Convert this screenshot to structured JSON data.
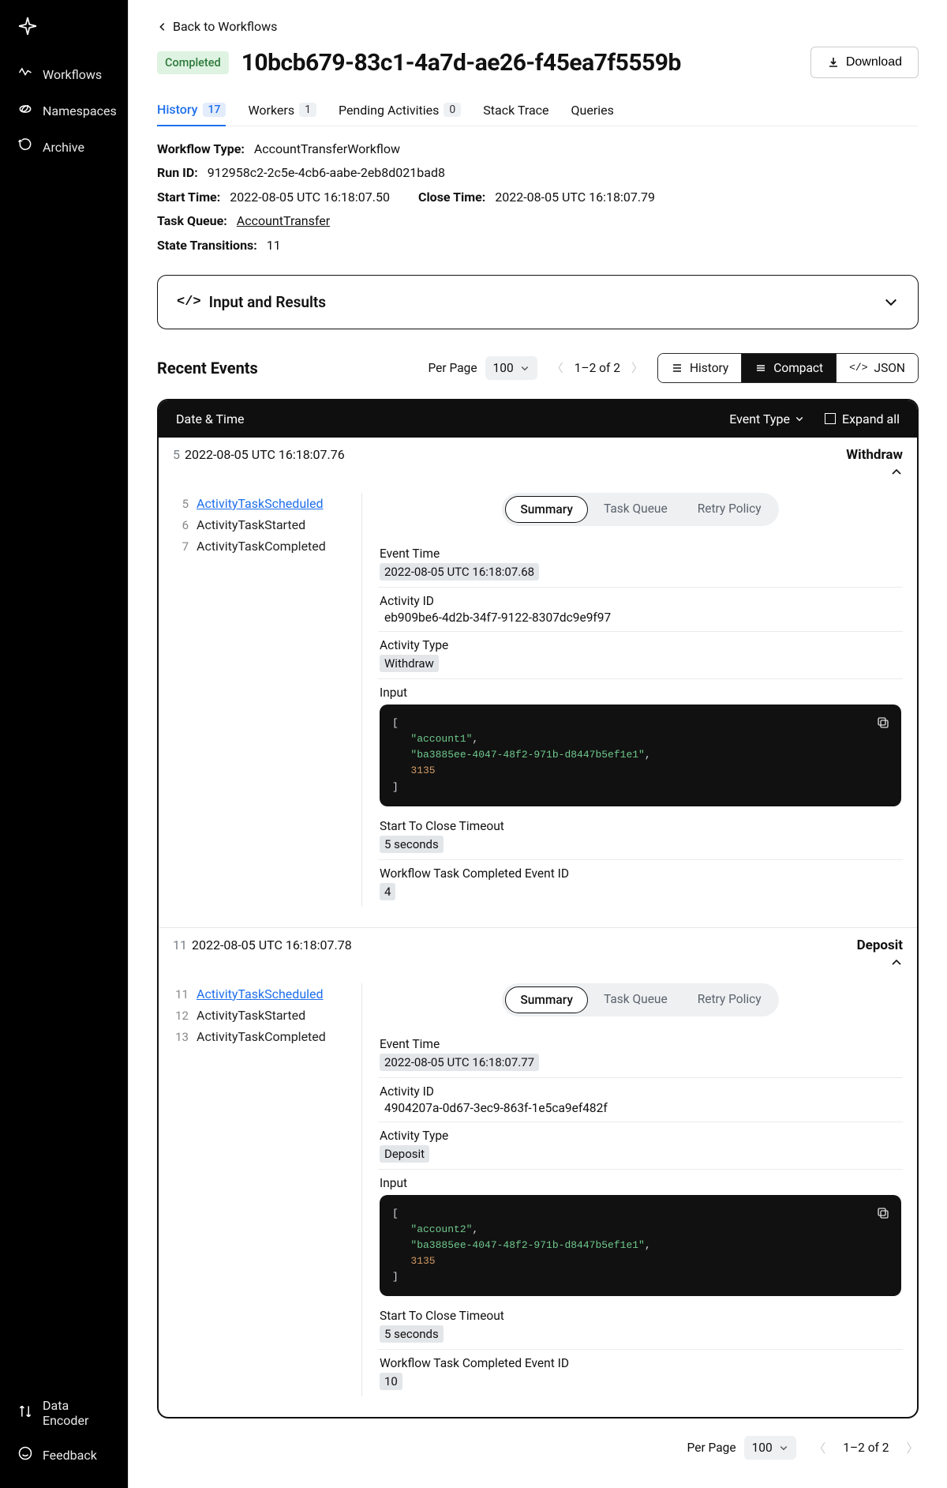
{
  "sidebar": {
    "top": [
      {
        "icon": "workflows",
        "label": "Workflows"
      },
      {
        "icon": "namespaces",
        "label": "Namespaces"
      },
      {
        "icon": "archive",
        "label": "Archive"
      }
    ],
    "bottom": [
      {
        "icon": "dataencoder",
        "label": "Data Encoder"
      },
      {
        "icon": "feedback",
        "label": "Feedback"
      }
    ]
  },
  "back_label": "Back to Workflows",
  "status": "Completed",
  "workflow_id": "10bcb679-83c1-4a7d-ae26-f45ea7f5559b",
  "download_label": "Download",
  "tabs": [
    {
      "label": "History",
      "badge": "17",
      "active": true
    },
    {
      "label": "Workers",
      "badge": "1"
    },
    {
      "label": "Pending Activities",
      "badge": "0"
    },
    {
      "label": "Stack Trace"
    },
    {
      "label": "Queries"
    }
  ],
  "meta": {
    "workflow_type_label": "Workflow Type:",
    "workflow_type_value": "AccountTransferWorkflow",
    "run_id_label": "Run ID:",
    "run_id_value": "912958c2-2c5e-4cb6-aabe-2eb8d021bad8",
    "start_time_label": "Start Time:",
    "start_time_value": "2022-08-05 UTC 16:18:07.50",
    "close_time_label": "Close Time:",
    "close_time_value": "2022-08-05 UTC 16:18:07.79",
    "task_queue_label": "Task Queue:",
    "task_queue_value": "AccountTransfer",
    "state_transitions_label": "State Transitions:",
    "state_transitions_value": "11"
  },
  "input_results_label": "Input and Results",
  "recent_events_label": "Recent Events",
  "per_page_label": "Per Page",
  "per_page_value": "100",
  "page_status": "1–2 of 2",
  "view_modes": {
    "history": "History",
    "compact": "Compact",
    "json": "JSON"
  },
  "events_head": {
    "date_time": "Date & Time",
    "event_type": "Event Type",
    "expand_all": "Expand all"
  },
  "detail_tabs": {
    "summary": "Summary",
    "task_queue": "Task Queue",
    "retry_policy": "Retry Policy"
  },
  "field_labels": {
    "event_time": "Event Time",
    "activity_id": "Activity ID",
    "activity_type": "Activity Type",
    "input": "Input",
    "start_to_close": "Start To Close Timeout",
    "wf_task_completed_id": "Workflow Task Completed Event ID"
  },
  "events": [
    {
      "num": "5",
      "ts": "2022-08-05 UTC 16:18:07.76",
      "name": "Withdraw",
      "subs": [
        {
          "n": "5",
          "label": "ActivityTaskScheduled",
          "active": true
        },
        {
          "n": "6",
          "label": "ActivityTaskStarted"
        },
        {
          "n": "7",
          "label": "ActivityTaskCompleted"
        }
      ],
      "detail": {
        "event_time": "2022-08-05 UTC 16:18:07.68",
        "activity_id": "eb909be6-4d2b-34f7-9122-8307dc9e9f97",
        "activity_type": "Withdraw",
        "input_account": "account1",
        "input_uuid": "ba3885ee-4047-48f2-971b-d8447b5ef1e1",
        "input_amount": "3135",
        "start_to_close": "5 seconds",
        "wf_task_completed_id": "4"
      }
    },
    {
      "num": "11",
      "ts": "2022-08-05 UTC 16:18:07.78",
      "name": "Deposit",
      "subs": [
        {
          "n": "11",
          "label": "ActivityTaskScheduled",
          "active": true
        },
        {
          "n": "12",
          "label": "ActivityTaskStarted"
        },
        {
          "n": "13",
          "label": "ActivityTaskCompleted"
        }
      ],
      "detail": {
        "event_time": "2022-08-05 UTC 16:18:07.77",
        "activity_id": "4904207a-0d67-3ec9-863f-1e5ca9ef482f",
        "activity_type": "Deposit",
        "input_account": "account2",
        "input_uuid": "ba3885ee-4047-48f2-971b-d8447b5ef1e1",
        "input_amount": "3135",
        "start_to_close": "5 seconds",
        "wf_task_completed_id": "10"
      }
    }
  ]
}
